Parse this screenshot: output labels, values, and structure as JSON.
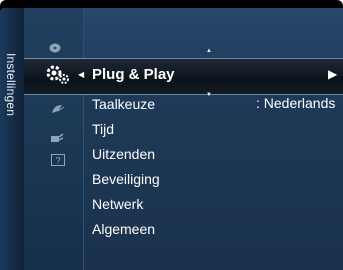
{
  "sidebar": {
    "tab_label": "Instellingen"
  },
  "menu": {
    "selected": {
      "label": "Plug & Play"
    },
    "items": [
      {
        "label": "Taalkeuze",
        "value": ": Nederlands"
      },
      {
        "label": "Tijd"
      },
      {
        "label": "Uitzenden"
      },
      {
        "label": "Beveiliging"
      },
      {
        "label": "Netwerk"
      },
      {
        "label": "Algemeen"
      }
    ]
  },
  "icons": {
    "column": [
      "disc-icon",
      "settings-gear-icon",
      "satellite-dish-icon",
      "plug-icon",
      "help-icon"
    ]
  },
  "colors": {
    "panel": "#1f3a58",
    "highlight": "#0c1118",
    "text": "#ffffff"
  }
}
